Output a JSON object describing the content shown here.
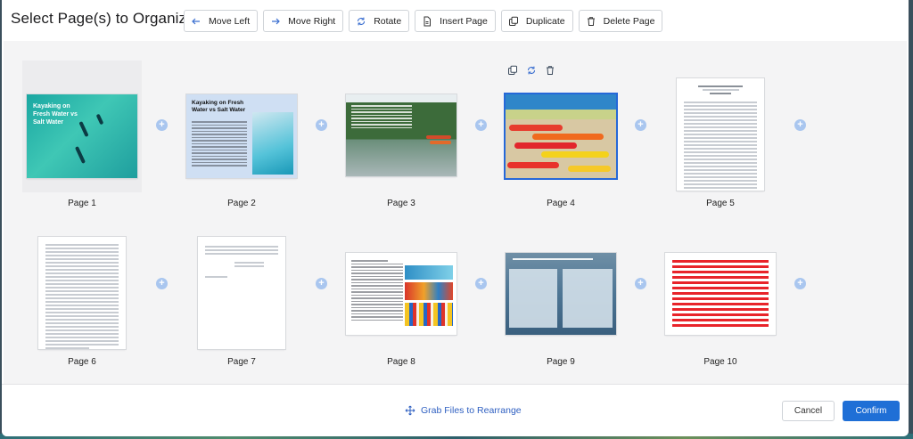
{
  "dialog": {
    "title": "Select Page(s) to Organize"
  },
  "toolbar": {
    "move_left": "Move Left",
    "move_right": "Move Right",
    "rotate": "Rotate",
    "insert_page": "Insert Page",
    "duplicate": "Duplicate",
    "delete_page": "Delete Page"
  },
  "pages": [
    {
      "label": "Page 1",
      "orientation": "landscape",
      "thumb_title": "Kayaking on Fresh Water vs Salt Water"
    },
    {
      "label": "Page 2",
      "orientation": "landscape",
      "thumb_title": "Kayaking on Fresh Water vs Salt Water"
    },
    {
      "label": "Page 3",
      "orientation": "landscape"
    },
    {
      "label": "Page 4",
      "orientation": "landscape",
      "selected": true
    },
    {
      "label": "Page 5",
      "orientation": "portrait"
    },
    {
      "label": "Page 6",
      "orientation": "portrait"
    },
    {
      "label": "Page 7",
      "orientation": "portrait"
    },
    {
      "label": "Page 8",
      "orientation": "landscape"
    },
    {
      "label": "Page 9",
      "orientation": "landscape"
    },
    {
      "label": "Page 10",
      "orientation": "landscape"
    }
  ],
  "footer": {
    "grab_hint": "Grab Files to Rearrange",
    "cancel": "Cancel",
    "confirm": "Confirm"
  },
  "colors": {
    "accent": "#1f6fd6",
    "selection": "#2568d8",
    "add_circle": "#a9c6ef",
    "grid_background": "#f4f4f5"
  },
  "icons": {
    "move_left": "arrow-left-icon",
    "move_right": "arrow-right-icon",
    "rotate": "rotate-icon",
    "insert_page": "insert-page-icon",
    "duplicate": "duplicate-icon",
    "delete_page": "trash-icon",
    "grab": "move-arrows-icon",
    "add": "plus-circle-icon"
  }
}
